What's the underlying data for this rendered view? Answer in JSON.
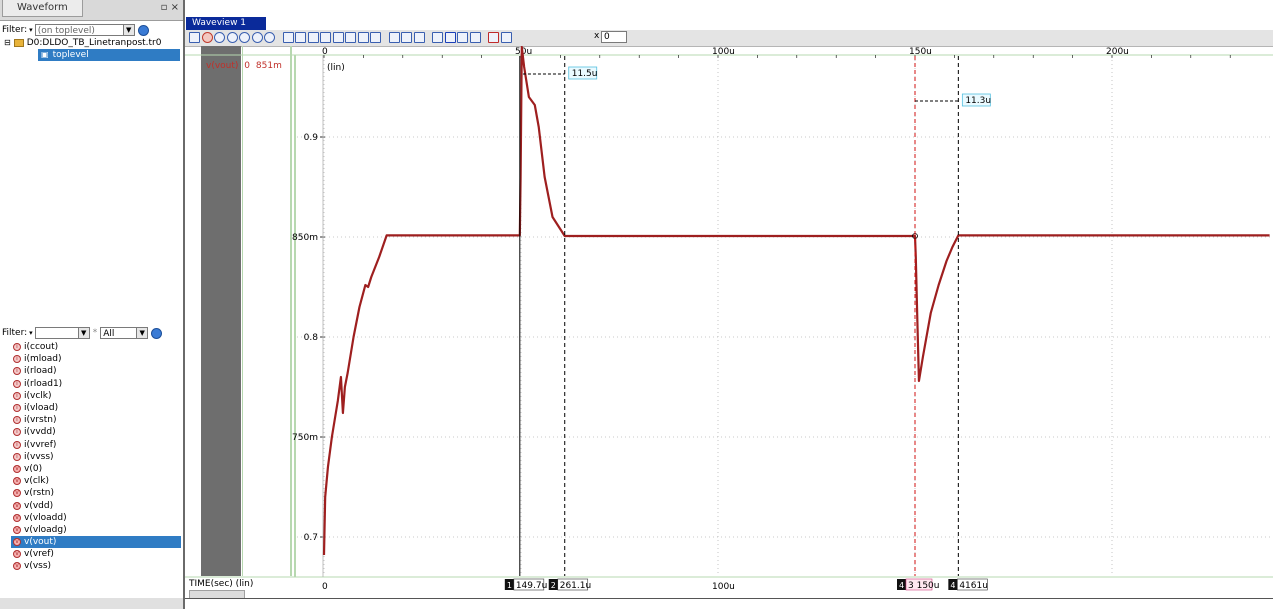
{
  "left_panel": {
    "tab": "Waveform",
    "filter_label": "Filter:",
    "filter_placeholder": "(on toplevel)",
    "tree": {
      "file": "D0:DLDO_TB_Linetranpost.tr0",
      "child": "toplevel"
    },
    "signal_filter_label": "Filter:",
    "signal_filter_scope": "All",
    "signals": [
      "i(ccout)",
      "i(mload)",
      "i(rload)",
      "i(rload1)",
      "i(vclk)",
      "i(vload)",
      "i(vrstn)",
      "i(vvdd)",
      "i(vvref)",
      "i(vvss)",
      "v(0)",
      "v(clk)",
      "v(rstn)",
      "v(vdd)",
      "v(vloadd)",
      "v(vloadg)",
      "v(vout)",
      "v(vref)",
      "v(vss)"
    ],
    "selected_signal": "v(vout)"
  },
  "waveview": {
    "tab": "Waveview 1",
    "x_field": "0",
    "x_label": "x",
    "signal_name": "v(vout)",
    "signal_value": "851m",
    "y_scale": "(lin)",
    "time_label": "TIME(sec) (lin)",
    "y_ticks": [
      "0.9",
      "850m",
      "0.8",
      "750m",
      "0.7"
    ],
    "x_ticks_top": [
      "0",
      "50u",
      "100u",
      "150u",
      "200u"
    ],
    "x_ticks_bottom": [
      "0",
      "100u"
    ],
    "cursors": [
      {
        "label": "149.7u",
        "num": "1"
      },
      {
        "label": "261.1u",
        "num": "2"
      },
      {
        "label": "3 150u",
        "num": "4"
      },
      {
        "label": "4161u",
        "num": "4"
      }
    ],
    "deltas": [
      "11.5u",
      "11.3u"
    ]
  },
  "colors": {
    "trace": "#9e1f1f",
    "cursor_red": "#d01010",
    "accent": "#0a2a9a"
  }
}
